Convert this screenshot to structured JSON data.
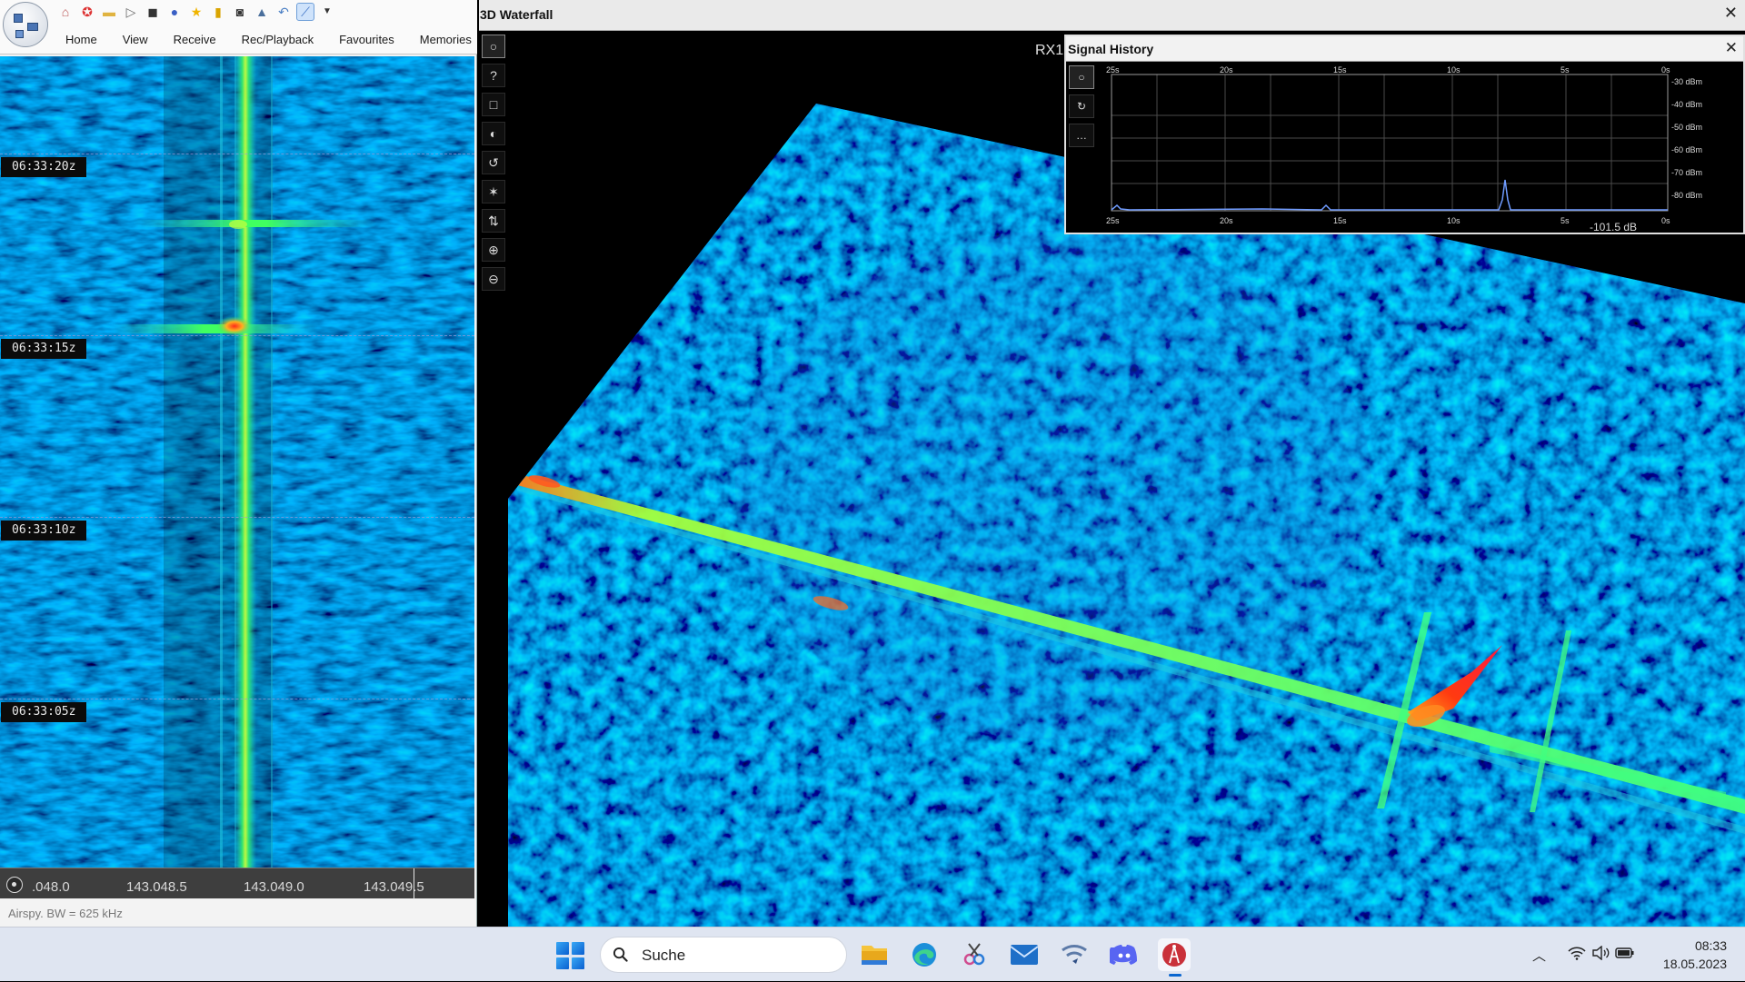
{
  "sdr": {
    "quick_access": [
      "home-icon",
      "lifebuoy-icon",
      "folder-icon",
      "play-icon",
      "stop-icon",
      "record-icon",
      "star-icon",
      "lock-icon",
      "camera-icon",
      "flask-icon",
      "undo-icon",
      "waterfall-icon",
      "dropdown-icon"
    ],
    "tabs": [
      "Home",
      "View",
      "Receive",
      "Rec/Playback",
      "Favourites",
      "Memories"
    ],
    "timestamps": [
      "06:33:20z",
      "06:33:15z",
      "06:33:10z",
      "06:33:05z"
    ],
    "freq_ticks": [
      ".048.0",
      "143.048.5",
      "143.049.0",
      "143.049.5"
    ],
    "status": "Airspy. BW = 625 kHz"
  },
  "wf3d": {
    "title": "3D Waterfall",
    "close": "✕",
    "tools": [
      "○",
      "?",
      "□",
      "◐",
      "↺",
      "✶",
      "⇅",
      "⊕",
      "⊖"
    ],
    "rx_label": "RX1"
  },
  "signal_history": {
    "title": "Signal History",
    "close": "✕",
    "buttons": [
      "○",
      "↻",
      "…"
    ],
    "time_labels": [
      "25s",
      "20s",
      "15s",
      "10s",
      "5s",
      "0s"
    ],
    "dbm_labels": [
      "-30 dBm",
      "-40 dBm",
      "-50 dBm",
      "-60 dBm",
      "-70 dBm",
      "-80 dBm"
    ],
    "readout": "-101.5 dB"
  },
  "taskbar": {
    "search_placeholder": "Suche",
    "apps": [
      "file-explorer-icon",
      "edge-icon",
      "snipping-tool-icon",
      "mail-icon",
      "network-app-icon",
      "discord-icon",
      "sdr-app-icon"
    ],
    "time": "08:33",
    "date": "18.05.2023"
  },
  "colors": {
    "waterfall_bg": "#0a1fa0",
    "signal": "#2cf06a",
    "peak": "#ff2a1a"
  }
}
